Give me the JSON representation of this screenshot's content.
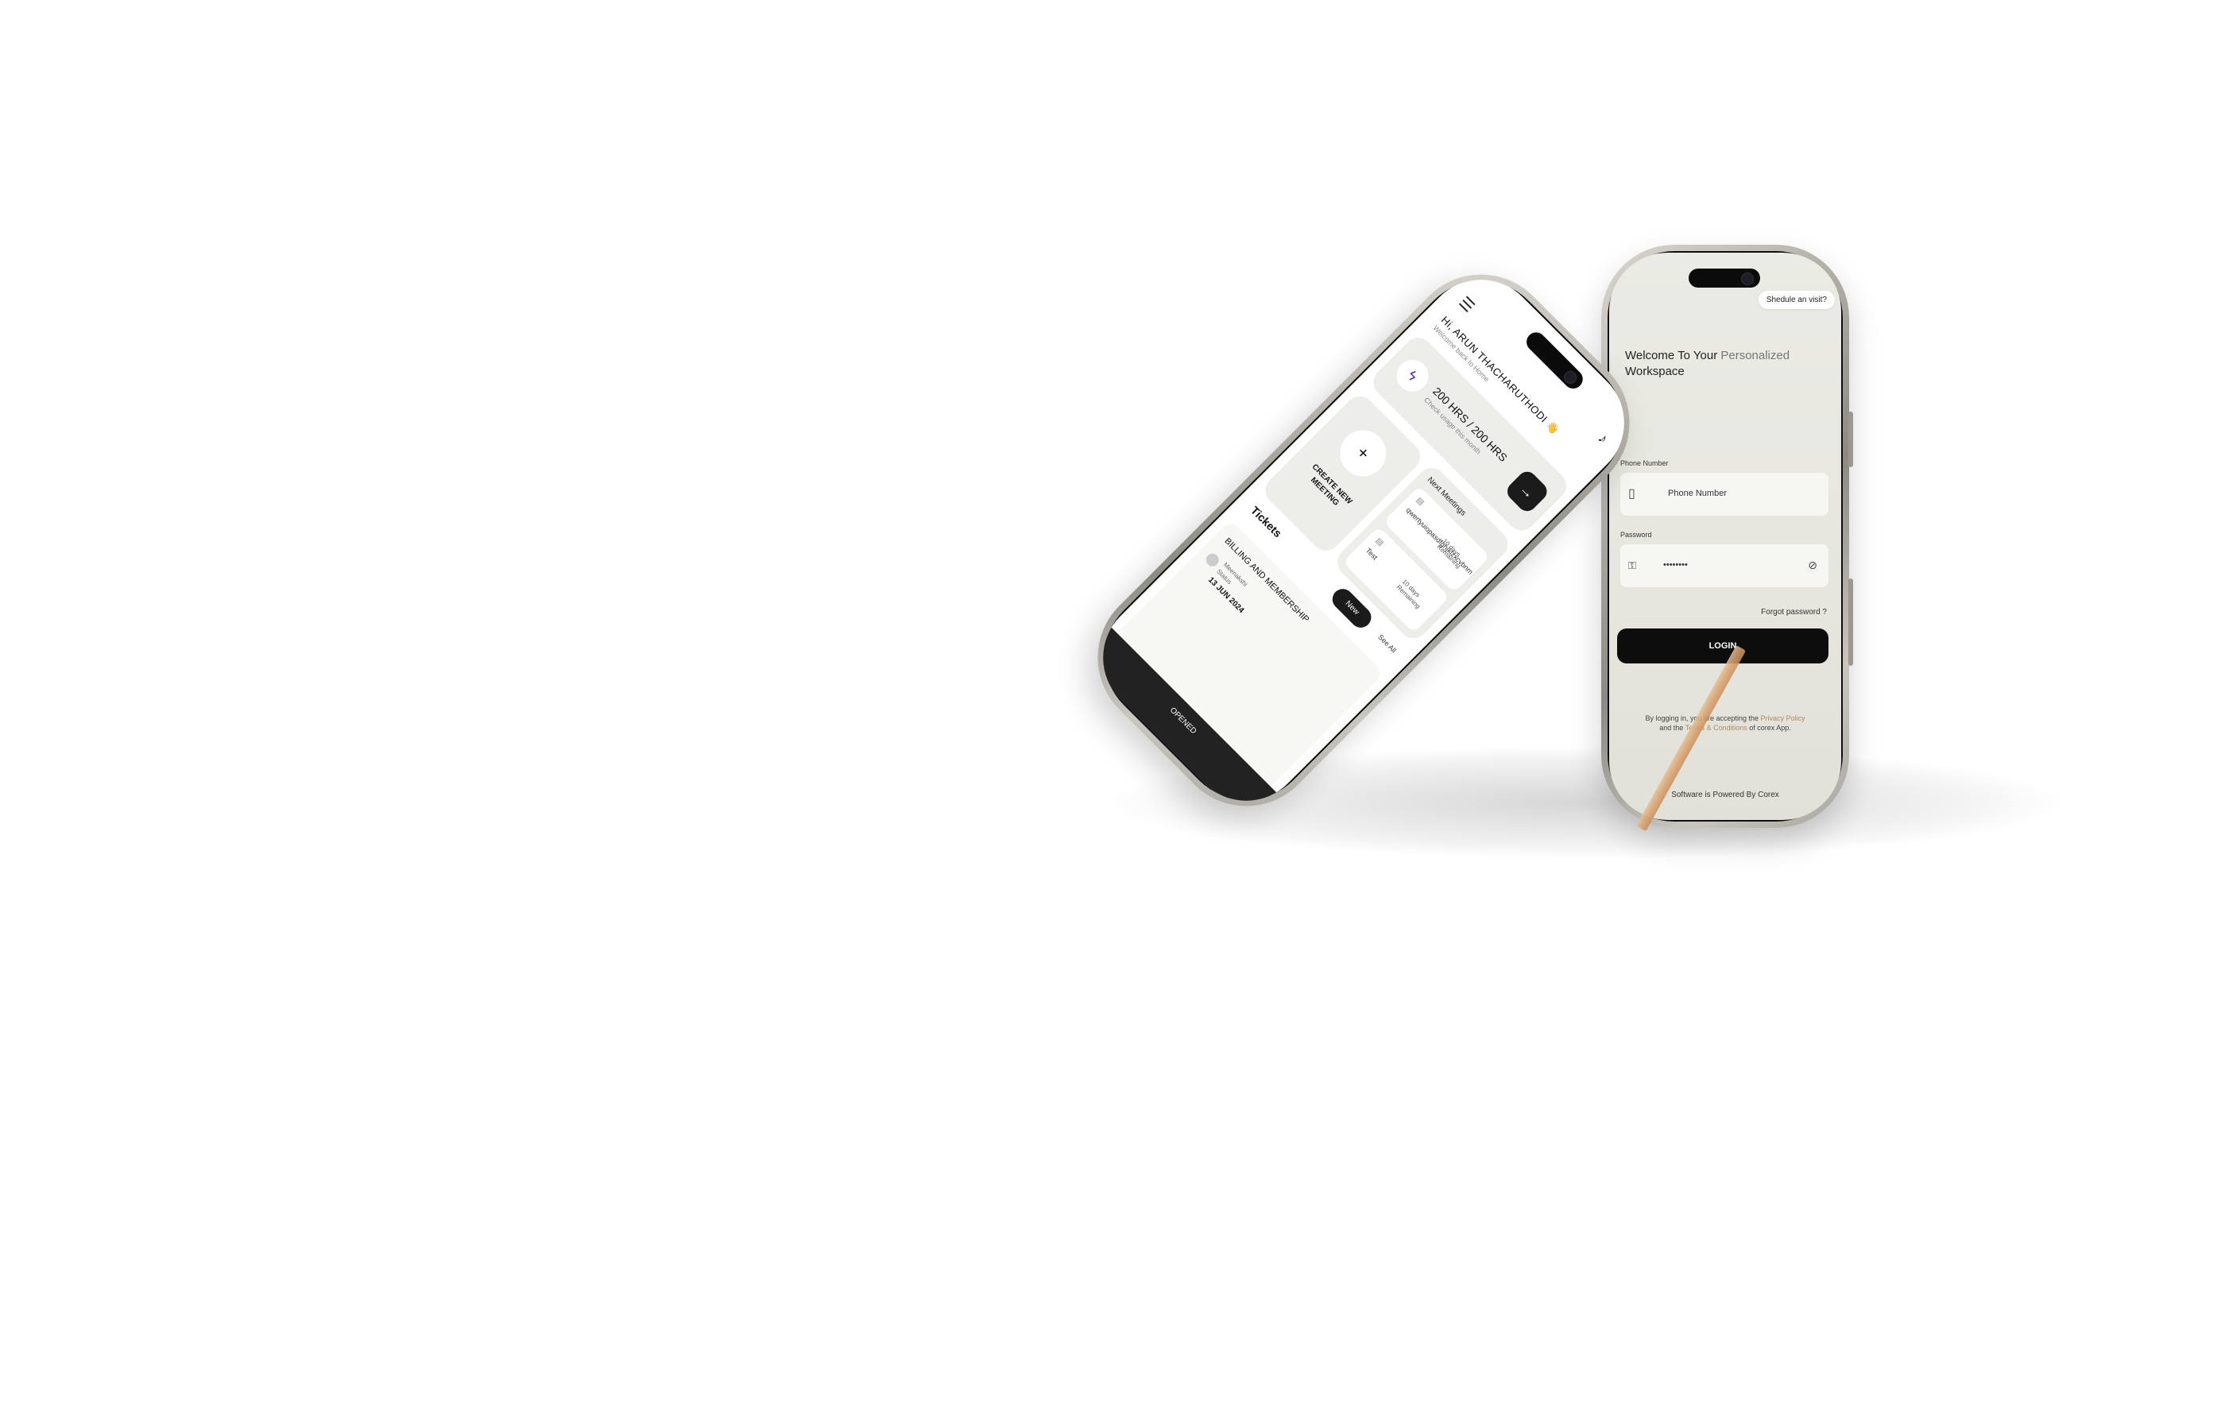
{
  "login": {
    "schedule_button": "Shedule an visit?",
    "welcome_line1": "Welcome To Your",
    "welcome_line1b": "Personalized",
    "welcome_line2": "Workspace",
    "phone_label": "Phone Number",
    "phone_placeholder": "Phone Number",
    "password_label": "Password",
    "password_value": "••••••••",
    "forgot": "Forgot password ?",
    "login_button": "LOGIN",
    "terms_prefix": "By logging in, you are accepting the",
    "privacy": "Privacy Policy",
    "and": "and the",
    "terms_link": "Terms & Conditions",
    "terms_suffix": "of corex App.",
    "powered": "Software is Powered By Corex"
  },
  "dashboard": {
    "greeting": "Hi, ARUN THACHARUTHODI 👋",
    "greeting_sub": "Welcome back to Home",
    "hours": "200 HRS / 200 HRS",
    "hours_sub": "Check usage this month",
    "create_meeting": "CREATE NEW MEETING",
    "next_meetings": "Next Meetings",
    "meetings": [
      {
        "name": "qwertyuiopasdfghjklzxcvbnm",
        "remaining": "10 days Remaining"
      },
      {
        "name": "Test",
        "remaining": "10 days Remaining"
      }
    ],
    "tickets_title": "Tickets",
    "new_button": "New",
    "see_all": "See All",
    "ticket": {
      "title": "BILLING AND MEMBERSHIP",
      "owner": "Meenakshi",
      "status": "Status",
      "date": "13 JUN 2024"
    },
    "opened_label": "OPENED"
  },
  "colors": {
    "accent_dark": "#1b1b1b",
    "bolt": "#5a2ea6",
    "link": "#b08a60"
  },
  "icons": {
    "menu": "hamburger",
    "bell": "bell",
    "bolt": "lightning-bolt",
    "arrow": "arrow-right",
    "plus": "plus",
    "phone": "mobile-phone",
    "key": "key",
    "eye": "eye-off"
  }
}
